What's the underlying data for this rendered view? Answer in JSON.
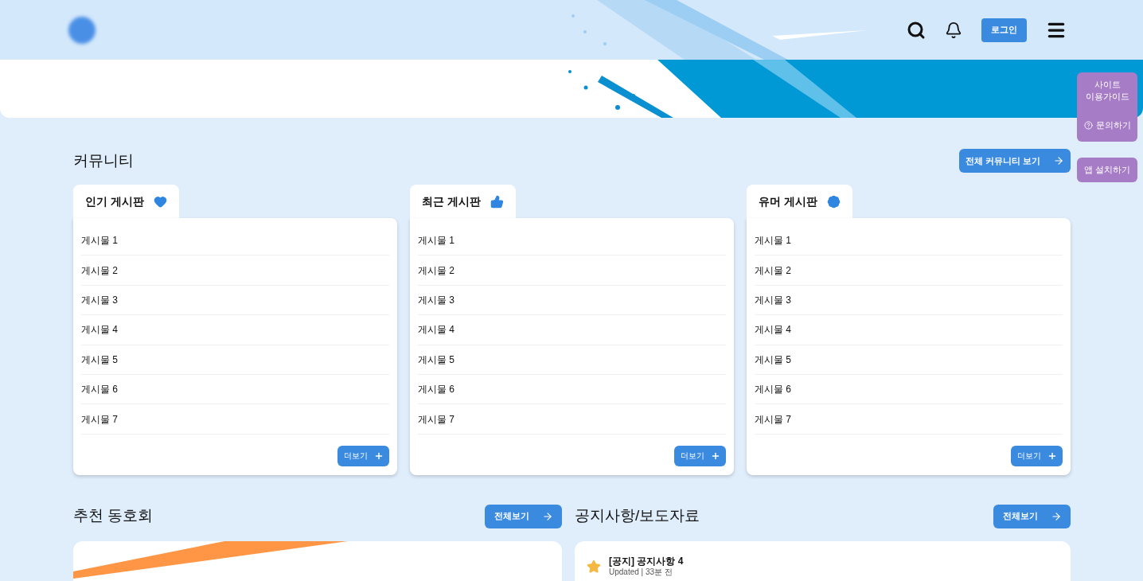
{
  "header": {
    "login_button": "로그인"
  },
  "side_panel": {
    "guide": "사이트 이용가이드",
    "inquiry": "문의하기",
    "install": "앱 설치하기"
  },
  "community": {
    "title": "커뮤니티",
    "view_all": "전체 커뮤니티 보기",
    "boards": [
      {
        "title": "인기 게시판",
        "kind": "heart",
        "posts": [
          "게시물 1",
          "게시물 2",
          "게시물 3",
          "게시물 4",
          "게시물 5",
          "게시물 6",
          "게시물 7"
        ],
        "more": "더보기"
      },
      {
        "title": "최근 게시판",
        "kind": "thumbs_up",
        "posts": [
          "게시물 1",
          "게시물 2",
          "게시물 3",
          "게시물 4",
          "게시물 5",
          "게시물 6",
          "게시물 7"
        ],
        "more": "더보기"
      },
      {
        "title": "유머 게시판",
        "kind": "seal",
        "posts": [
          "게시물 1",
          "게시물 2",
          "게시물 3",
          "게시물 4",
          "게시물 5",
          "게시물 6",
          "게시물 7"
        ],
        "more": "더보기"
      }
    ]
  },
  "clubs": {
    "title": "추천 동호회",
    "view_all": "전체보기"
  },
  "notices": {
    "title": "공지사항/보도자료",
    "view_all": "전체보기",
    "items": [
      {
        "title": "[공지] 공지사항 4",
        "meta": "Updated | 33분 전"
      }
    ]
  }
}
